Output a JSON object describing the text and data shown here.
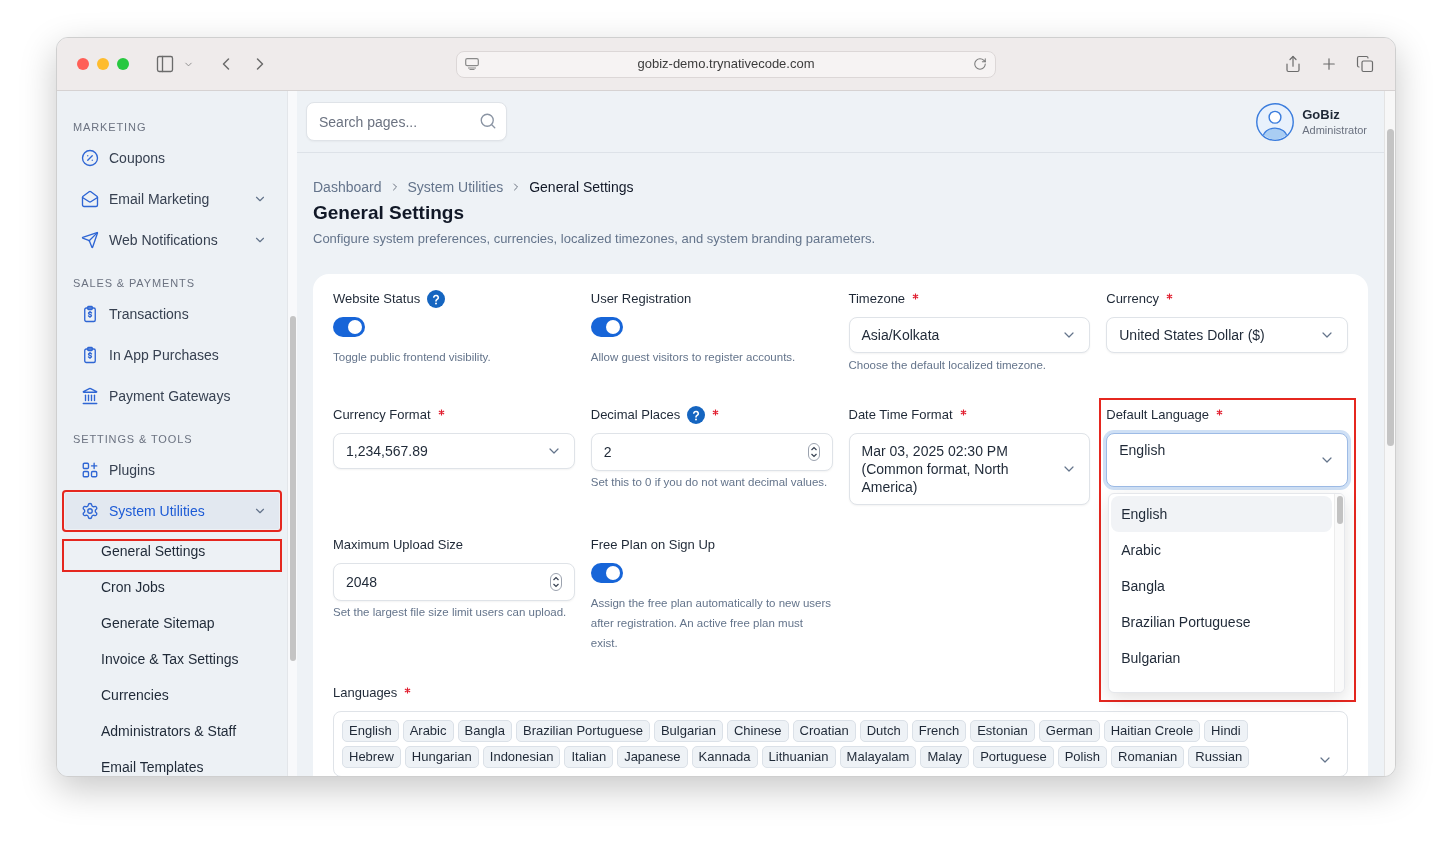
{
  "browser": {
    "url": "gobiz-demo.trynativecode.com"
  },
  "sidebar": {
    "sections": [
      {
        "heading": "MARKETING",
        "items": [
          {
            "label": "Coupons",
            "selected": false,
            "expandable": false,
            "highlighted": false
          },
          {
            "label": "Email Marketing",
            "selected": false,
            "expandable": true,
            "highlighted": false
          },
          {
            "label": "Web Notifications",
            "selected": false,
            "expandable": true,
            "highlighted": false
          }
        ]
      },
      {
        "heading": "SALES & PAYMENTS",
        "items": [
          {
            "label": "Transactions",
            "selected": false,
            "expandable": false,
            "highlighted": false
          },
          {
            "label": "In App Purchases",
            "selected": false,
            "expandable": false,
            "highlighted": false
          },
          {
            "label": "Payment Gateways",
            "selected": false,
            "expandable": false,
            "highlighted": false
          }
        ]
      },
      {
        "heading": "SETTINGS & TOOLS",
        "items": [
          {
            "label": "Plugins",
            "selected": false,
            "expandable": false,
            "highlighted": false
          },
          {
            "label": "System Utilities",
            "selected": true,
            "expandable": true,
            "highlighted": true,
            "children": [
              {
                "label": "General Settings",
                "highlighted": true
              },
              {
                "label": "Cron Jobs",
                "highlighted": false
              },
              {
                "label": "Generate Sitemap",
                "highlighted": false
              },
              {
                "label": "Invoice & Tax Settings",
                "highlighted": false
              },
              {
                "label": "Currencies",
                "highlighted": false
              },
              {
                "label": "Administrators & Staff",
                "highlighted": false
              },
              {
                "label": "Email Templates",
                "highlighted": false
              }
            ]
          }
        ]
      }
    ]
  },
  "header": {
    "search": {
      "placeholder": "Search pages..."
    },
    "user": {
      "name": "GoBiz",
      "role": "Administrator"
    }
  },
  "breadcrumb": [
    {
      "label": "Dashboard",
      "current": false
    },
    {
      "label": "System Utilities",
      "current": false
    },
    {
      "label": "General Settings",
      "current": true
    }
  ],
  "page": {
    "title": "General Settings",
    "description": "Configure system preferences, currencies, localized timezones, and system branding parameters."
  },
  "settings": {
    "fields": [
      {
        "kind": "toggle",
        "label": "Website Status",
        "help_icon": true,
        "on": true,
        "hint": "Toggle public frontend visibility."
      },
      {
        "kind": "toggle",
        "label": "User Registration",
        "on": true,
        "hint": "Allow guest visitors to register accounts."
      },
      {
        "kind": "select",
        "label": "Timezone",
        "required": true,
        "value": "Asia/Kolkata",
        "expanded": false,
        "hint": "Choose the default localized timezone."
      },
      {
        "kind": "select",
        "label": "Currency",
        "required": true,
        "value": "United States Dollar ($)",
        "expanded": false
      },
      {
        "kind": "select",
        "label": "Currency Format",
        "required": true,
        "value": "1,234,567.89",
        "expanded": false
      },
      {
        "kind": "number",
        "label": "Decimal Places",
        "help_icon": true,
        "required": true,
        "value": "2",
        "hint": "Set this to 0 if you do not want decimal values."
      },
      {
        "kind": "select",
        "label": "Date Time Format",
        "required": true,
        "value": "Mar 03, 2025 02:30 PM (Common format, North America)",
        "expanded": false
      },
      {
        "kind": "select",
        "label": "Default Language",
        "required": true,
        "highlighted": true,
        "value": "English",
        "expanded": true,
        "options": [
          {
            "label": "English",
            "selected": true
          },
          {
            "label": "Arabic",
            "selected": false
          },
          {
            "label": "Bangla",
            "selected": false
          },
          {
            "label": "Brazilian Portuguese",
            "selected": false
          },
          {
            "label": "Bulgarian",
            "selected": false
          }
        ]
      },
      {
        "kind": "number",
        "label": "Maximum Upload Size",
        "value": "2048",
        "hint": "Set the largest file size limit users can upload."
      },
      {
        "kind": "toggle",
        "label": "Free Plan on Sign Up",
        "on": true,
        "hint": "Assign the free plan automatically to new users after registration. An active free plan must exist."
      }
    ]
  },
  "languages": {
    "label": "Languages",
    "required": true,
    "tags": [
      "English",
      "Arabic",
      "Bangla",
      "Brazilian Portuguese",
      "Bulgarian",
      "Chinese",
      "Croatian",
      "Dutch",
      "French",
      "Estonian",
      "German",
      "Haitian Creole",
      "Hindi",
      "Hebrew",
      "Hungarian",
      "Indonesian",
      "Italian",
      "Japanese",
      "Kannada",
      "Lithuanian",
      "Malayalam",
      "Malay",
      "Portuguese",
      "Polish",
      "Romanian",
      "Russian"
    ]
  }
}
